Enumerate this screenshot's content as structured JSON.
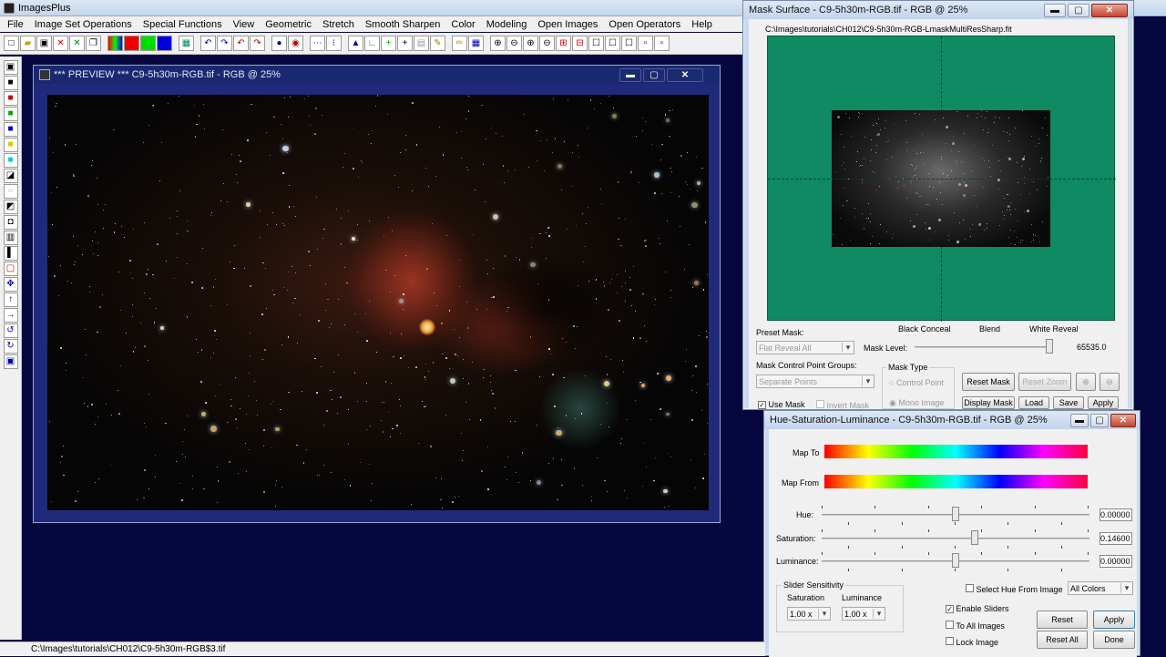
{
  "app": {
    "title": "ImagesPlus"
  },
  "menu": [
    "File",
    "Image Set Operations",
    "Special Functions",
    "View",
    "Geometric",
    "Stretch",
    "Smooth Sharpen",
    "Color",
    "Modeling",
    "Open Images",
    "Open Operators",
    "Help"
  ],
  "preview": {
    "title": "*** PREVIEW *** C9-5h30m-RGB.tif - RGB @ 25%"
  },
  "mask": {
    "title": "Mask Surface - C9-5h30m-RGB.tif - RGB @ 25%",
    "path": "C:\\Images\\tutorials\\CH012\\C9-5h30m-RGB-LmaskMultiResSharp.fit",
    "preset_label": "Preset Mask:",
    "preset_value": "Flat Reveal All",
    "level_label": "Mask Level:",
    "black_conceal": "Black Conceal",
    "blend": "Blend",
    "white_reveal": "White Reveal",
    "level_value": "65535.0",
    "level_fraction": 1.0,
    "groups_label": "Mask Control Point Groups:",
    "groups_value": "Separate Points",
    "type_label": "Mask Type",
    "type_cp": "Control Point",
    "type_mono": "Mono Image",
    "reset_mask": "Reset Mask",
    "reset_zoom": "Reset Zoom",
    "use_mask": "Use Mask",
    "invert_mask": "Invert Mask",
    "display_mask": "Display Mask",
    "load": "Load",
    "save": "Save",
    "apply": "Apply"
  },
  "hsl": {
    "title": "Hue-Saturation-Luminance - C9-5h30m-RGB.tif - RGB @ 25%",
    "map_to": "Map To",
    "map_from": "Map From",
    "hue_label": "Hue:",
    "hue_value": "0.00000",
    "hue_pos": 0.5,
    "sat_label": "Saturation:",
    "sat_value": "0.14600",
    "sat_pos": 0.573,
    "lum_label": "Luminance:",
    "lum_value": "0.00000",
    "lum_pos": 0.5,
    "sens_label": "Slider Sensitivity",
    "sens_sat": "Saturation",
    "sens_lum": "Luminance",
    "sens_sat_value": "1.00 x",
    "sens_lum_value": "1.00 x",
    "select_hue": "Select Hue From Image",
    "colors_value": "All Colors",
    "enable_sliders": "Enable Sliders",
    "to_all_images": "To All Images",
    "lock_image": "Lock Image",
    "reset": "Reset",
    "apply": "Apply",
    "reset_all": "Reset All",
    "done": "Done"
  },
  "status": {
    "path": "C:\\Images\\tutorials\\CH012\\C9-5h30m-RGB$3.tif"
  }
}
